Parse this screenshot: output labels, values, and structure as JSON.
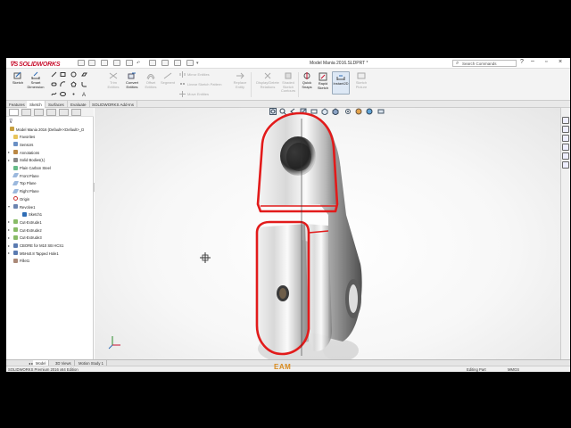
{
  "app": {
    "logo_text": "SOLIDWORKS",
    "doc_title": "Model Mania 2016.SLDPRT *",
    "search_placeholder": "Search Commands",
    "colors": {
      "brand": "#c8102e",
      "sketch_red": "#e21b1b",
      "accent_blue": "#2f6db5"
    }
  },
  "toolbar": {
    "commands": [
      {
        "id": "sketch",
        "label": "Sketch",
        "icon": "sketch-icon"
      },
      {
        "id": "smart-dimension",
        "label": "Smart\nDimension",
        "icon": "smart-dimension-icon"
      },
      {
        "id": "trim-entities",
        "label": "Trim\nEntities",
        "icon": "trim-icon"
      },
      {
        "id": "convert-entities",
        "label": "Convert\nEntities",
        "icon": "convert-icon"
      },
      {
        "id": "offset-entities",
        "label": "Offset\nEntities",
        "icon": "offset-icon"
      },
      {
        "id": "segment",
        "label": "Segment",
        "icon": "segment-icon"
      },
      {
        "id": "display-delete",
        "label": "Display/Delete\nRelations",
        "icon": "relations-icon"
      },
      {
        "id": "repair-sketch",
        "label": "Repair\nSketch",
        "icon": "repair-icon"
      },
      {
        "id": "quick-snaps",
        "label": "Quick\nSnaps",
        "icon": "quick-snaps-icon"
      },
      {
        "id": "rapid-sketch",
        "label": "Rapid\nSketch",
        "icon": "rapid-sketch-icon"
      },
      {
        "id": "instant2d",
        "label": "Instant2D",
        "icon": "instant2d-icon"
      },
      {
        "id": "sketch-picture",
        "label": "Sketch\nPicture",
        "icon": "picture-icon"
      }
    ],
    "mirror_label": "Mirror Entities",
    "linear_pattern_label": "Linear Sketch Pattern",
    "move_label": "Move Entities",
    "replace_label": "Replace\nEntity",
    "shaded_label": "Shaded\nSketch\nContours"
  },
  "tabs": [
    "Features",
    "Sketch",
    "Surfaces",
    "Evaluate",
    "SOLIDWORKS Add-Ins"
  ],
  "active_tab": "Sketch",
  "tree": {
    "root": "Model Mania 2016  (Default<<Default>_D",
    "items": [
      {
        "label": "Favorites",
        "icon": "folder-icon",
        "expandable": false
      },
      {
        "label": "Sensors",
        "icon": "sensor-icon",
        "expandable": false
      },
      {
        "label": "Annotations",
        "icon": "annotation-icon",
        "expandable": true
      },
      {
        "label": "Solid Bodies(1)",
        "icon": "solid-bodies-icon",
        "expandable": true
      },
      {
        "label": "Plain Carbon Steel",
        "icon": "material-icon",
        "expandable": false
      },
      {
        "label": "Front Plane",
        "icon": "plane-icon",
        "expandable": false
      },
      {
        "label": "Top Plane",
        "icon": "plane-icon",
        "expandable": false
      },
      {
        "label": "Right Plane",
        "icon": "plane-icon",
        "expandable": false
      },
      {
        "label": "Origin",
        "icon": "origin-icon",
        "expandable": false
      },
      {
        "label": "Revolve1",
        "icon": "revolve-icon",
        "expandable": true,
        "expanded": true
      },
      {
        "label": "Sketch1",
        "icon": "sketch-icon",
        "expandable": false,
        "child": true
      },
      {
        "label": "Cut-Extrude1",
        "icon": "cut-extrude-icon",
        "expandable": true
      },
      {
        "label": "Cut-Extrude2",
        "icon": "cut-extrude-icon",
        "expandable": true
      },
      {
        "label": "Cut-Extrude3",
        "icon": "cut-extrude-icon",
        "expandable": true
      },
      {
        "label": "CBORE for M10 SB HCS1",
        "icon": "hole-icon",
        "expandable": true
      },
      {
        "label": "M5Hx0.8 Tapped Hole1",
        "icon": "hole-icon",
        "expandable": true
      },
      {
        "label": "Fillet1",
        "icon": "fillet-icon",
        "expandable": false
      }
    ]
  },
  "bottom_tabs": [
    "Model",
    "3D Views",
    "Motion Study 1"
  ],
  "status": {
    "left": "SOLIDWORKS Premium 2016 x64 Edition",
    "mode": "Editing Part",
    "units": "MMGS"
  },
  "watermark": "EAM"
}
